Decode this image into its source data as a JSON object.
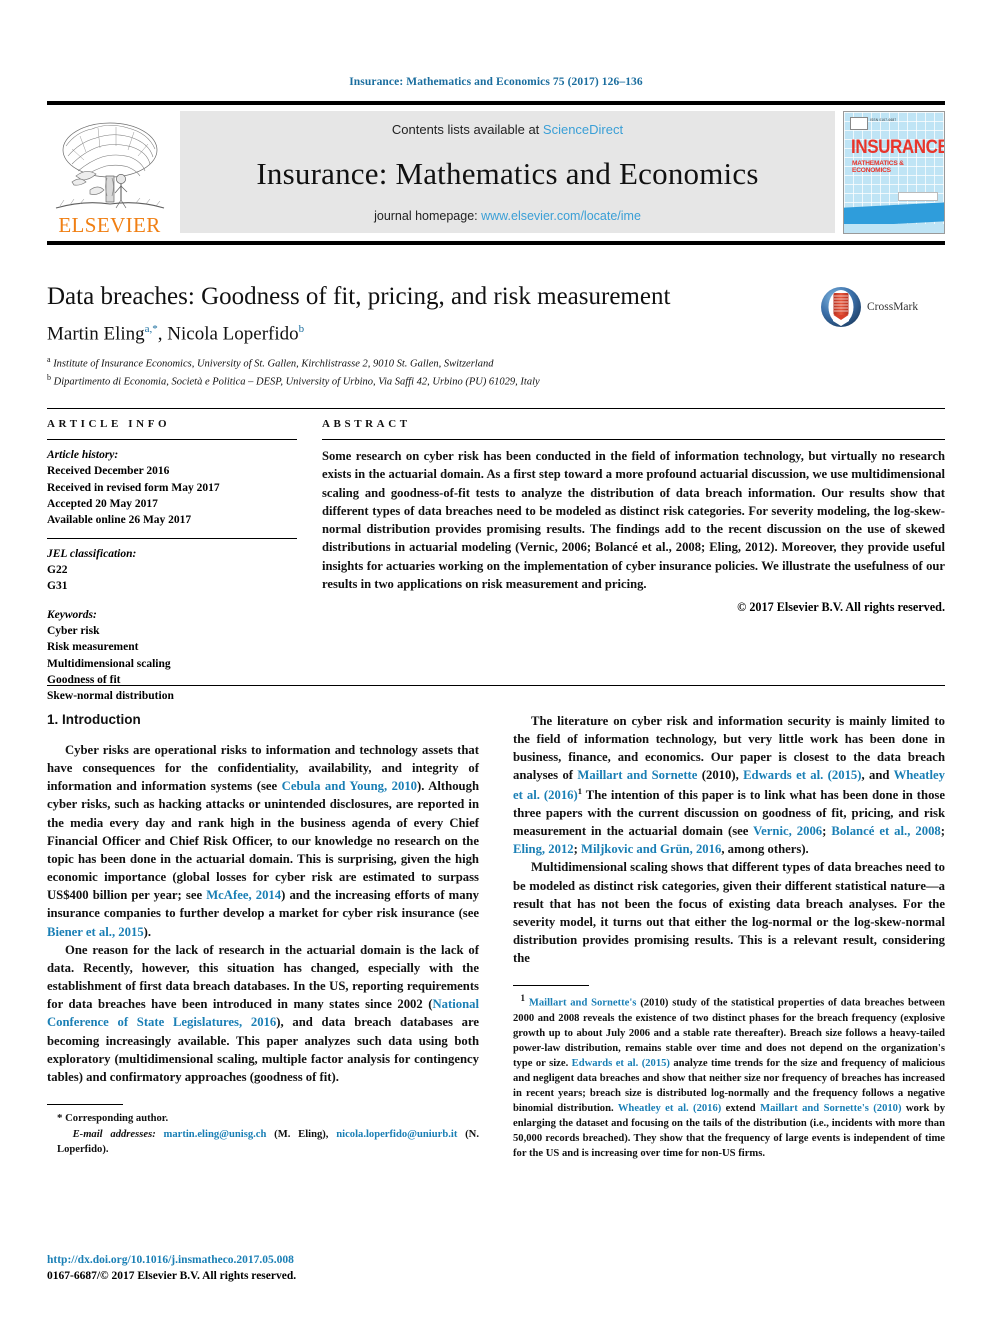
{
  "running_head": "Insurance: Mathematics and Economics 75 (2017) 126–136",
  "masthead": {
    "contents_prefix": "Contents lists available at ",
    "sciencedirect": "ScienceDirect",
    "journal_name": "Insurance: Mathematics and Economics",
    "homepage_prefix": "journal homepage: ",
    "homepage_url": "www.elsevier.com/locate/ime",
    "publisher_wordmark": "ELSEVIER",
    "publisher_logo_icon": "elsevier-tree-icon",
    "cover": {
      "title": "INSURANCE",
      "subtitle": "MATHEMATICS & ECONOMICS",
      "masthead_small": "ISSN 0167-6687",
      "accent_red": "#e8352b",
      "accent_blue": "#2f9ddb"
    }
  },
  "title_block": {
    "title": "Data breaches: Goodness of fit, pricing, and risk measurement",
    "authors_1": "Martin Eling",
    "authors_1_sup": "a,*",
    "authors_sep": ", ",
    "authors_2": "Nicola Loperfido",
    "authors_2_sup": "b",
    "affiliation_a_marker": "a",
    "affiliation_a": "Institute of Insurance Economics, University of St. Gallen, Kirchlistrasse 2, 9010 St. Gallen, Switzerland",
    "affiliation_b_marker": "b",
    "affiliation_b": "Dipartimento di Economia, Società e Politica – DESP, University of Urbino, Via Saffi 42, Urbino (PU) 61029, Italy",
    "crossmark_label": "CrossMark",
    "crossmark_icon": "crossmark-icon"
  },
  "article_info": {
    "heading": "ARTICLE INFO",
    "history_label": "Article history:",
    "history": [
      "Received December 2016",
      "Received in revised form May 2017",
      "Accepted 20 May 2017",
      "Available online 26 May 2017"
    ],
    "jel_label": "JEL classification:",
    "jel": [
      "G22",
      "G31"
    ],
    "keywords_label": "Keywords:",
    "keywords": [
      "Cyber risk",
      "Risk measurement",
      "Multidimensional scaling",
      "Goodness of fit",
      "Skew-normal distribution"
    ]
  },
  "abstract": {
    "heading": "ABSTRACT",
    "text": "Some research on cyber risk has been conducted in the field of information technology, but virtually no research exists in the actuarial domain. As a first step toward a more profound actuarial discussion, we use multidimensional scaling and goodness-of-fit tests to analyze the distribution of data breach information. Our results show that different types of data breaches need to be modeled as distinct risk categories. For severity modeling, the log-skew-normal distribution provides promising results. The findings add to the recent discussion on the use of skewed distributions in actuarial modeling (Vernic, 2006; Bolancé et al., 2008; Eling, 2012). Moreover, they provide useful insights for actuaries working on the implementation of cyber insurance policies. We illustrate the usefulness of our results in two applications on risk measurement and pricing.",
    "copyright": "© 2017 Elsevier B.V. All rights reserved."
  },
  "body": {
    "section_1_heading": "1. Introduction",
    "left_p1_a": "Cyber risks are operational risks to information and technology assets that have consequences for the confidentiality, availability, and integrity of information and information systems (see ",
    "left_p1_ref1": "Cebula and Young, 2010",
    "left_p1_b": "). Although cyber risks, such as hacking attacks or unintended disclosures, are reported in the media every day and rank high in the business agenda of every Chief Financial Officer and Chief Risk Officer, to our knowledge no research on the topic has been done in the actuarial domain. This is surprising, given the high economic importance (global losses for cyber risk are estimated to surpass US$400 billion per year; see ",
    "left_p1_ref2": "McAfee, 2014",
    "left_p1_c": ") and the increasing efforts of many insurance companies to further develop a market for cyber risk insurance (see ",
    "left_p1_ref3": "Biener et al., 2015",
    "left_p1_d": ").",
    "left_p2_a": "One reason for the lack of research in the actuarial domain is the lack of data. Recently, however, this situation has changed, especially with the establishment of first data breach databases. In the US, reporting requirements for data breaches have been introduced in many states since 2002 (",
    "left_p2_ref1": "National Conference of State Legislatures, 2016",
    "left_p2_b": "), and data breach databases are becoming increasingly available. This paper analyzes such data using both exploratory (multidimensional scaling, multiple factor analysis for contingency tables) and confirmatory approaches (goodness of fit).",
    "right_p1_a": "The literature on cyber risk and information security is mainly limited to the field of information technology, but very little work has been done in business, finance, and economics. Our paper is closest to the data breach analyses of ",
    "right_p1_ref1": "Maillart and Sornette",
    "right_p1_ref1b": " (2010)",
    "right_p1_mid1": ", ",
    "right_p1_ref2": "Edwards et al. (2015)",
    "right_p1_mid2": ", and ",
    "right_p1_ref3": "Wheatley et al. (2016)",
    "right_p1_fn": "1",
    "right_p1_b": " The intention of this paper is to link what has been done in those three papers with the current discussion on goodness of fit, pricing, and risk measurement in the actuarial domain (see ",
    "right_p1_ref4": "Vernic, 2006",
    "right_p1_semi1": "; ",
    "right_p1_ref5": "Bolancé et al., 2008",
    "right_p1_semi2": "; ",
    "right_p1_ref6": "Eling, 2012",
    "right_p1_semi3": "; ",
    "right_p1_ref7": "Miljkovic and Grün, 2016",
    "right_p1_c": ", among others).",
    "right_p2": "Multidimensional scaling shows that different types of data breaches need to be modeled as distinct risk categories, given their different statistical nature—a result that has not been the focus of existing data breach analyses. For the severity model, it turns out that either the log-normal or the log-skew-normal distribution provides promising results. This is a relevant result, considering the"
  },
  "footnotes": {
    "left_star": "*",
    "left_corresponding": "Corresponding author.",
    "left_email_label": "E-mail addresses:",
    "left_email_1": "martin.eling@unisg.ch",
    "left_email_1_who": " (M. Eling), ",
    "left_email_2": "nicola.loperfido@uniurb.it",
    "left_email_2_who": " (N. Loperfido).",
    "right_num": "1",
    "right_ref1": "Maillart and Sornette's",
    "right_a": " (2010) study of the statistical properties of data breaches between 2000 and 2008 reveals the existence of two distinct phases for the breach frequency (explosive growth up to about July 2006 and a stable rate thereafter). Breach size follows a heavy-tailed power-law distribution, remains stable over time and does not depend on the organization's type or size. ",
    "right_ref2": "Edwards et al. (2015)",
    "right_b": " analyze time trends for the size and frequency of malicious and negligent data breaches and show that neither size nor frequency of breaches has increased in recent years; breach size is distributed log-normally and the frequency follows a negative binomial distribution. ",
    "right_ref3": "Wheatley et al. (2016)",
    "right_c": " extend ",
    "right_ref4": "Maillart and Sornette's (2010)",
    "right_d": " work by enlarging the dataset and focusing on the tails of the distribution (i.e., incidents with more than 50,000 records breached). They show that the frequency of large events is independent of time for the US and is increasing over time for non-US firms."
  },
  "footer": {
    "doi": "http://dx.doi.org/10.1016/j.insmatheco.2017.05.008",
    "issn_line": "0167-6687/© 2017 Elsevier B.V. All rights reserved."
  },
  "colors": {
    "link_blue": "#1a7fb5",
    "running_head_blue": "#1a6d9e",
    "elsevier_orange": "#f07f13",
    "sciencedirect_blue": "#3a9fd6"
  }
}
